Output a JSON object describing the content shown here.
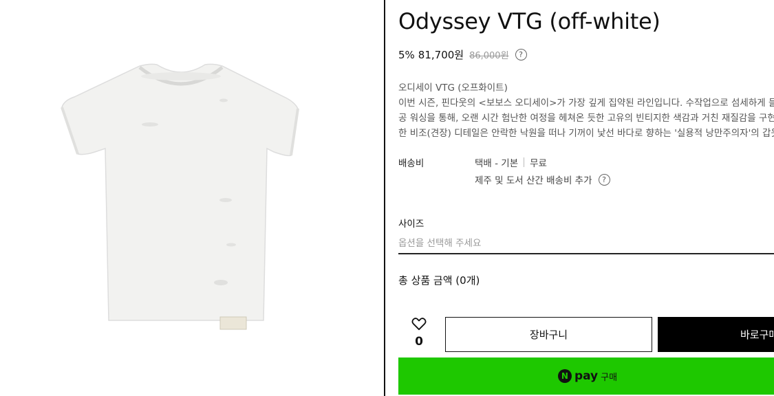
{
  "product": {
    "title": "Odyssey VTG (off-white)",
    "discount": "5%",
    "price": "81,700원",
    "original_price": "86,000원",
    "image_icon": "tshirt-image"
  },
  "description": {
    "lines": [
      "오디세이 VTG (오프화이트)",
      "이번 시즌, 핀다웃의 <보보스 오디세이>가 가장 깊게 집약된 라인입니다. 수작업으로 섬세하게 들어",
      "공 워싱을 통해, 오랜 시간 험난한 여정을 헤쳐온 듯한 고유의 빈티지한 색감과 거친 재질감을 구현했",
      "한 비조(견장) 디테일은 안락한 낙원을 떠나 기꺼이 낯선 바다로 향하는 '실용적 낭만주의자'의 갑옷"
    ]
  },
  "shipping": {
    "label": "배송비",
    "method": "택배 - 기본",
    "fee": "무료",
    "extra_note": "제주 및 도서 산간 배송비 추가"
  },
  "size": {
    "label": "사이즈",
    "placeholder": "옵션을 선택해 주세요"
  },
  "total": {
    "label": "총 상품 금액 (0개)"
  },
  "actions": {
    "like_count": "0",
    "cart_label": "장바구니",
    "buy_label": "바로구매",
    "npay_logo": "N",
    "npay_word": "pay",
    "npay_buy": "구매"
  },
  "colors": {
    "npay_green": "#1ec800",
    "buy_black": "#000000"
  }
}
